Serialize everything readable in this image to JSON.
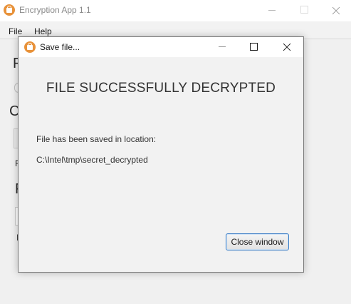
{
  "main_window": {
    "title": "Encryption App 1.1",
    "menu": {
      "file": "File",
      "help": "Help"
    },
    "background_fragments": {
      "big1": "F",
      "big2": "C",
      "big3": "F",
      "small1": "F",
      "small2": "I"
    }
  },
  "dialog": {
    "title": "Save file...",
    "heading": "FILE SUCCESSFULLY DECRYPTED",
    "label": "File has been saved in location:",
    "path": "C:\\Intel\\tmp\\secret_decrypted",
    "close_button": "Close window"
  },
  "colors": {
    "accent": "#3d7fc6",
    "app_icon": "#e8923a",
    "window_bg": "#f0f0f0"
  },
  "icons": {
    "app": "lock-house-icon",
    "minimize": "minimize-icon",
    "maximize": "maximize-icon",
    "close": "close-icon"
  }
}
